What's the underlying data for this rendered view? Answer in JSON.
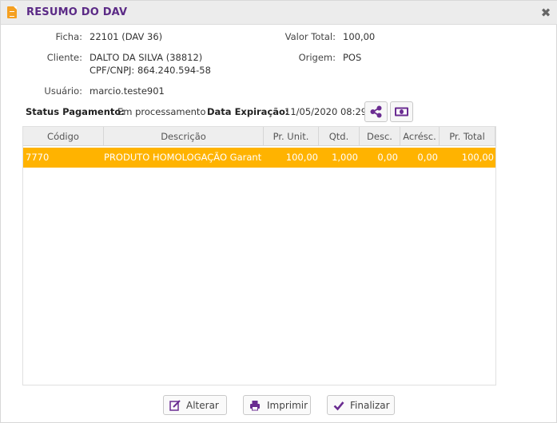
{
  "window": {
    "title": "RESUMO DO DAV",
    "close_label": "✖"
  },
  "fields": {
    "ficha_label": "Ficha:",
    "ficha_value": "22101 (DAV 36)",
    "cliente_label": "Cliente:",
    "cliente_value": "DALTO DA SILVA (38812)",
    "cpf_value": "CPF/CNPJ: 864.240.594-58",
    "usuario_label": "Usuário:",
    "usuario_value": "marcio.teste901",
    "valor_total_label": "Valor Total:",
    "valor_total_value": "100,00",
    "origem_label": "Origem:",
    "origem_value": "POS"
  },
  "status": {
    "pagamento_label": "Status Pagamento:",
    "pagamento_value": "Em processamento",
    "expiracao_label": "Data Expiração:",
    "expiracao_value": "11/05/2020 08:29"
  },
  "table": {
    "columns": [
      "Código",
      "Descrição",
      "Pr. Unit.",
      "Qtd.",
      "Desc.",
      "Acrésc.",
      "Pr. Total"
    ],
    "rows": [
      {
        "codigo": "7770",
        "descricao": "PRODUTO HOMOLOGAÇÃO Garantia le",
        "pr_unit": "100,00",
        "qtd": "1,000",
        "desc": "0,00",
        "acresc": "0,00",
        "pr_total": "100,00"
      }
    ]
  },
  "buttons": {
    "alterar": "Alterar",
    "imprimir": "Imprimir",
    "finalizar": "Finalizar"
  },
  "colors": {
    "title": "#5b2a86",
    "selected_row": "#ffb300",
    "icon_purple": "#6a2c91",
    "doc_icon": "#f5a021"
  },
  "icons": [
    "document-icon",
    "close-icon",
    "share-icon",
    "money-icon",
    "edit-icon",
    "printer-icon",
    "check-icon"
  ]
}
